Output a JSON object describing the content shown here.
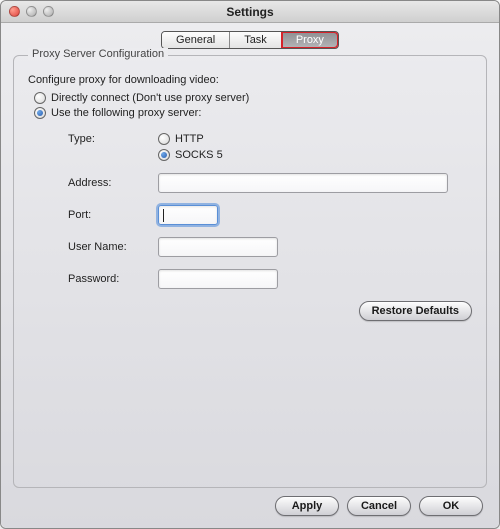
{
  "window": {
    "title": "Settings"
  },
  "tabs": {
    "general": "General",
    "task": "Task",
    "proxy": "Proxy",
    "active": "proxy"
  },
  "group": {
    "legend": "Proxy Server Configuration",
    "description": "Configure proxy for downloading video:"
  },
  "mode": {
    "direct_label": "Directly connect (Don't use proxy server)",
    "use_proxy_label": "Use the following proxy server:",
    "selected": "use_proxy"
  },
  "proxy": {
    "type_label": "Type:",
    "type_http": "HTTP",
    "type_socks5": "SOCKS 5",
    "type_selected": "socks5",
    "address_label": "Address:",
    "address_value": "",
    "port_label": "Port:",
    "port_value": "",
    "username_label": "User Name:",
    "username_value": "",
    "password_label": "Password:",
    "password_value": ""
  },
  "buttons": {
    "restore": "Restore Defaults",
    "apply": "Apply",
    "cancel": "Cancel",
    "ok": "OK"
  }
}
